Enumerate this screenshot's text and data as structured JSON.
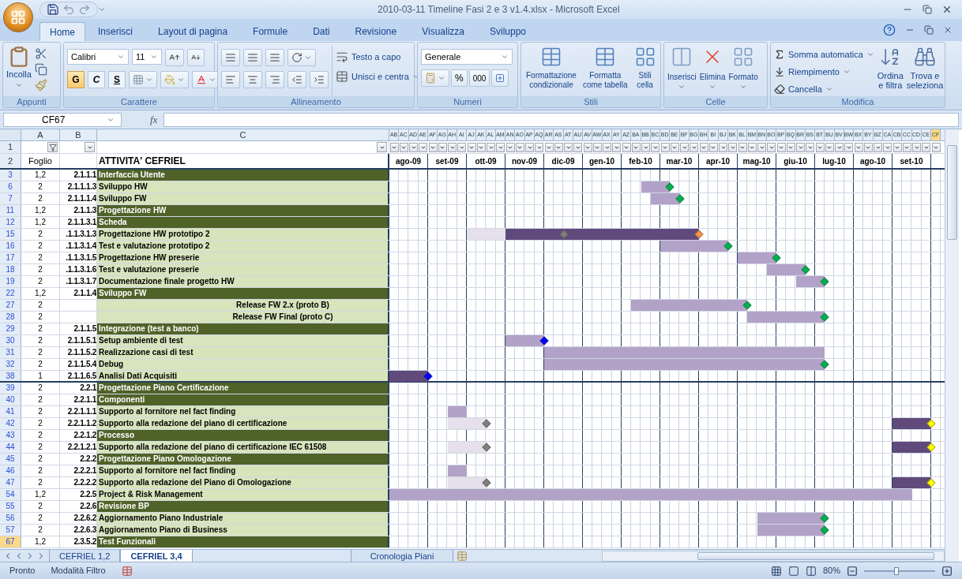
{
  "window": {
    "title": "2010-03-11 Timeline Fasi 2 e 3 v1.4.xlsx - Microsoft Excel"
  },
  "ribbon_tabs": [
    {
      "label": "Home",
      "selected": true
    },
    {
      "label": "Inserisci",
      "selected": false
    },
    {
      "label": "Layout di pagina",
      "selected": false
    },
    {
      "label": "Formule",
      "selected": false
    },
    {
      "label": "Dati",
      "selected": false
    },
    {
      "label": "Revisione",
      "selected": false
    },
    {
      "label": "Visualizza",
      "selected": false
    },
    {
      "label": "Sviluppo",
      "selected": false
    }
  ],
  "clipboard": {
    "label": "Appunti",
    "paste": "Incolla"
  },
  "font": {
    "label": "Carattere",
    "name": "Calibri",
    "size": "11",
    "bold": "G",
    "italic": "C",
    "underline": "S"
  },
  "alignment": {
    "label": "Allineamento",
    "wrap": "Testo a capo",
    "merge": "Unisci e centra"
  },
  "number": {
    "label": "Numeri",
    "format": "Generale",
    "percent": "%",
    "thousands": "000"
  },
  "styles": {
    "label": "Stili",
    "buttons": [
      [
        "Formattazione",
        "condizionale"
      ],
      [
        "Formatta",
        "come tabella"
      ],
      [
        "Stili",
        "cella"
      ]
    ]
  },
  "cells": {
    "label": "Celle",
    "buttons": [
      "Inserisci",
      "Elimina",
      "Formato"
    ]
  },
  "editing": {
    "label": "Modifica",
    "items": [
      "Somma automatica",
      "Riempimento",
      "Cancella"
    ],
    "buttons": [
      [
        "Ordina",
        "e filtra"
      ],
      [
        "Trova e",
        "seleziona"
      ]
    ]
  },
  "formula_bar": {
    "name_box": "CF67",
    "fx": "fx"
  },
  "columns": [
    {
      "label": "A",
      "filter_active": true
    },
    {
      "label": "B",
      "filter_active": false
    },
    {
      "label": "C",
      "filter_active": false
    }
  ],
  "gantt_columns": [
    {
      "label": "AB",
      "selected": false
    },
    {
      "label": "AC",
      "selected": false
    },
    {
      "label": "AD",
      "selected": false
    },
    {
      "label": "AE",
      "selected": false
    },
    {
      "label": "AF",
      "selected": false
    },
    {
      "label": "AG",
      "selected": false
    },
    {
      "label": "AH",
      "selected": false
    },
    {
      "label": "AI",
      "selected": false
    },
    {
      "label": "AJ",
      "selected": false
    },
    {
      "label": "AK",
      "selected": false
    },
    {
      "label": "AL",
      "selected": false
    },
    {
      "label": "AM",
      "selected": false
    },
    {
      "label": "AN",
      "selected": false
    },
    {
      "label": "AO",
      "selected": false
    },
    {
      "label": "AP",
      "selected": false
    },
    {
      "label": "AQ",
      "selected": false
    },
    {
      "label": "AR",
      "selected": false
    },
    {
      "label": "AS",
      "selected": false
    },
    {
      "label": "AT",
      "selected": false
    },
    {
      "label": "AU",
      "selected": false
    },
    {
      "label": "AV",
      "selected": false
    },
    {
      "label": "AW",
      "selected": false
    },
    {
      "label": "AX",
      "selected": false
    },
    {
      "label": "AY",
      "selected": false
    },
    {
      "label": "AZ",
      "selected": false
    },
    {
      "label": "BA",
      "selected": false
    },
    {
      "label": "BB",
      "selected": false
    },
    {
      "label": "BC",
      "selected": false
    },
    {
      "label": "BD",
      "selected": false
    },
    {
      "label": "BE",
      "selected": false
    },
    {
      "label": "BF",
      "selected": false
    },
    {
      "label": "BG",
      "selected": false
    },
    {
      "label": "BH",
      "selected": false
    },
    {
      "label": "BI",
      "selected": false
    },
    {
      "label": "BJ",
      "selected": false
    },
    {
      "label": "BK",
      "selected": false
    },
    {
      "label": "BL",
      "selected": false
    },
    {
      "label": "BM",
      "selected": false
    },
    {
      "label": "BN",
      "selected": false
    },
    {
      "label": "BO",
      "selected": false
    },
    {
      "label": "BP",
      "selected": false
    },
    {
      "label": "BQ",
      "selected": false
    },
    {
      "label": "BR",
      "selected": false
    },
    {
      "label": "BS",
      "selected": false
    },
    {
      "label": "BT",
      "selected": false
    },
    {
      "label": "BU",
      "selected": false
    },
    {
      "label": "BV",
      "selected": false
    },
    {
      "label": "BW",
      "selected": false
    },
    {
      "label": "BX",
      "selected": false
    },
    {
      "label": "BY",
      "selected": false
    },
    {
      "label": "BZ",
      "selected": false
    },
    {
      "label": "CA",
      "selected": false
    },
    {
      "label": "CB",
      "selected": false
    },
    {
      "label": "CC",
      "selected": false
    },
    {
      "label": "CD",
      "selected": false
    },
    {
      "label": "CE",
      "selected": false
    },
    {
      "label": "CF",
      "selected": true
    }
  ],
  "header_row": {
    "num": "1",
    "num2": "2",
    "foglio": "Foglio",
    "activity": "ATTIVITA' CEFRIEL",
    "months": [
      "ago-09",
      "set-09",
      "ott-09",
      "nov-09",
      "dic-09",
      "gen-10",
      "feb-10",
      "mar-10",
      "apr-10",
      "mag-10",
      "giu-10",
      "lug-10",
      "ago-10",
      "set-10"
    ]
  },
  "rows": [
    {
      "num": "3",
      "foglio": "1,2",
      "code": "2.1.1.1",
      "name": "Interfaccia Utente",
      "kind": "section",
      "selected": false
    },
    {
      "num": "6",
      "foglio": "2",
      "code": "2.1.1.1.3",
      "name": "Sviluppo HW",
      "kind": "task",
      "selected": false
    },
    {
      "num": "7",
      "foglio": "2",
      "code": "2.1.1.1.4",
      "name": "Sviluppo FW",
      "kind": "task",
      "selected": false
    },
    {
      "num": "11",
      "foglio": "1,2",
      "code": "2.1.1.3",
      "name": "Progettazione HW",
      "kind": "section",
      "selected": false
    },
    {
      "num": "12",
      "foglio": "1,2",
      "code": "2.1.1.3.1",
      "name": "Scheda",
      "kind": "section",
      "selected": false
    },
    {
      "num": "15",
      "foglio": "2",
      "code": ".1.1.3.1.3",
      "name": "Progettazione HW prototipo 2",
      "kind": "task",
      "selected": false
    },
    {
      "num": "16",
      "foglio": "2",
      "code": ".1.1.3.1.4",
      "name": "Test e valutazione prototipo 2",
      "kind": "task",
      "selected": false
    },
    {
      "num": "17",
      "foglio": "2",
      "code": ".1.1.3.1.5",
      "name": "Progettazione HW preserie",
      "kind": "task",
      "selected": false
    },
    {
      "num": "18",
      "foglio": "2",
      "code": ".1.1.3.1.6",
      "name": "Test e valutazione preserie",
      "kind": "task",
      "selected": false
    },
    {
      "num": "19",
      "foglio": "2",
      "code": ".1.1.3.1.7",
      "name": "Documentazione finale progetto HW",
      "kind": "task",
      "selected": false
    },
    {
      "num": "22",
      "foglio": "1,2",
      "code": "2.1.1.4",
      "name": "Sviluppo FW",
      "kind": "section",
      "selected": false
    },
    {
      "num": "27",
      "foglio": "2",
      "name": "Release FW 2.x (proto B)",
      "kind": "release",
      "selected": false
    },
    {
      "num": "28",
      "foglio": "2",
      "name": "Release FW Final (proto C)",
      "kind": "release",
      "selected": false
    },
    {
      "num": "29",
      "foglio": "2",
      "code": "2.1.1.5",
      "name": "Integrazione (test a banco)",
      "kind": "section",
      "selected": false
    },
    {
      "num": "30",
      "foglio": "2",
      "code": "2.1.1.5.1",
      "name": "Setup ambiente di test",
      "kind": "task",
      "selected": false
    },
    {
      "num": "31",
      "foglio": "2",
      "code": "2.1.1.5.2",
      "name": "Realizzazione casi di test",
      "kind": "task",
      "selected": false
    },
    {
      "num": "32",
      "foglio": "2",
      "code": "2.1.1.5.4",
      "name": "Debug",
      "kind": "task",
      "selected": false
    },
    {
      "num": "38",
      "foglio": "1",
      "code": "2.1.1.6.5",
      "name": "Analisi Dati Acquisiti",
      "kind": "task",
      "selected": false
    },
    {
      "num": "39",
      "foglio": "2",
      "code": "2.2.1",
      "name": "Progettazione Piano Certificazione",
      "kind": "section",
      "selected": false
    },
    {
      "num": "40",
      "foglio": "2",
      "code": "2.2.1.1",
      "name": "Componenti",
      "kind": "section",
      "selected": false
    },
    {
      "num": "41",
      "foglio": "2",
      "code": "2.2.1.1.1",
      "name": "Supporto al fornitore nel fact finding",
      "kind": "task",
      "selected": false
    },
    {
      "num": "42",
      "foglio": "2",
      "code": "2.2.1.1.2",
      "name": "Supporto alla redazione del piano di certificazione",
      "kind": "task",
      "selected": false
    },
    {
      "num": "43",
      "foglio": "2",
      "code": "2.2.1.2",
      "name": "Processo",
      "kind": "section",
      "selected": false
    },
    {
      "num": "44",
      "foglio": "2",
      "code": "2.2.1.2.1",
      "name": "Supporto alla redazione del piano di certificazione IEC 61508",
      "kind": "task",
      "selected": false
    },
    {
      "num": "45",
      "foglio": "2",
      "code": "2.2.2",
      "name": "Progettazione Piano Omologazione",
      "kind": "section",
      "selected": false
    },
    {
      "num": "46",
      "foglio": "2",
      "code": "2.2.2.1",
      "name": "Supporto al fornitore nel fact finding",
      "kind": "task",
      "selected": false
    },
    {
      "num": "47",
      "foglio": "2",
      "code": "2.2.2.2",
      "name": "Supporto alla redazione del Piano di Omologazione",
      "kind": "task",
      "selected": false
    },
    {
      "num": "54",
      "foglio": "1,2",
      "code": "2.2.5",
      "name": "Project & Risk Management",
      "kind": "task",
      "selected": false
    },
    {
      "num": "55",
      "foglio": "2",
      "code": "2.2.6",
      "name": "Revisione BP",
      "kind": "section",
      "selected": false
    },
    {
      "num": "56",
      "foglio": "2",
      "code": "2.2.6.2",
      "name": "Aggiornamento Piano Industriale",
      "kind": "task",
      "selected": false
    },
    {
      "num": "57",
      "foglio": "2",
      "code": "2.2.6.3",
      "name": "Aggiornamento Piano di Business",
      "kind": "task",
      "selected": false
    },
    {
      "num": "67",
      "foglio": "1,2",
      "code": "2.3.5.2",
      "name": "Test Funzionali",
      "kind": "section",
      "selected": true
    }
  ],
  "sheet_tabs": [
    {
      "label": "CEFRIEL 1,2",
      "selected": false
    },
    {
      "label": "CEFRIEL 3,4",
      "selected": true
    },
    {
      "label": "Cronologia Piani",
      "selected": false
    }
  ],
  "status_bar": {
    "ready": "Pronto",
    "mode": "Modalità Filtro",
    "zoom": "80%",
    "zoom_slider": {
      "level": 0.45
    }
  }
}
